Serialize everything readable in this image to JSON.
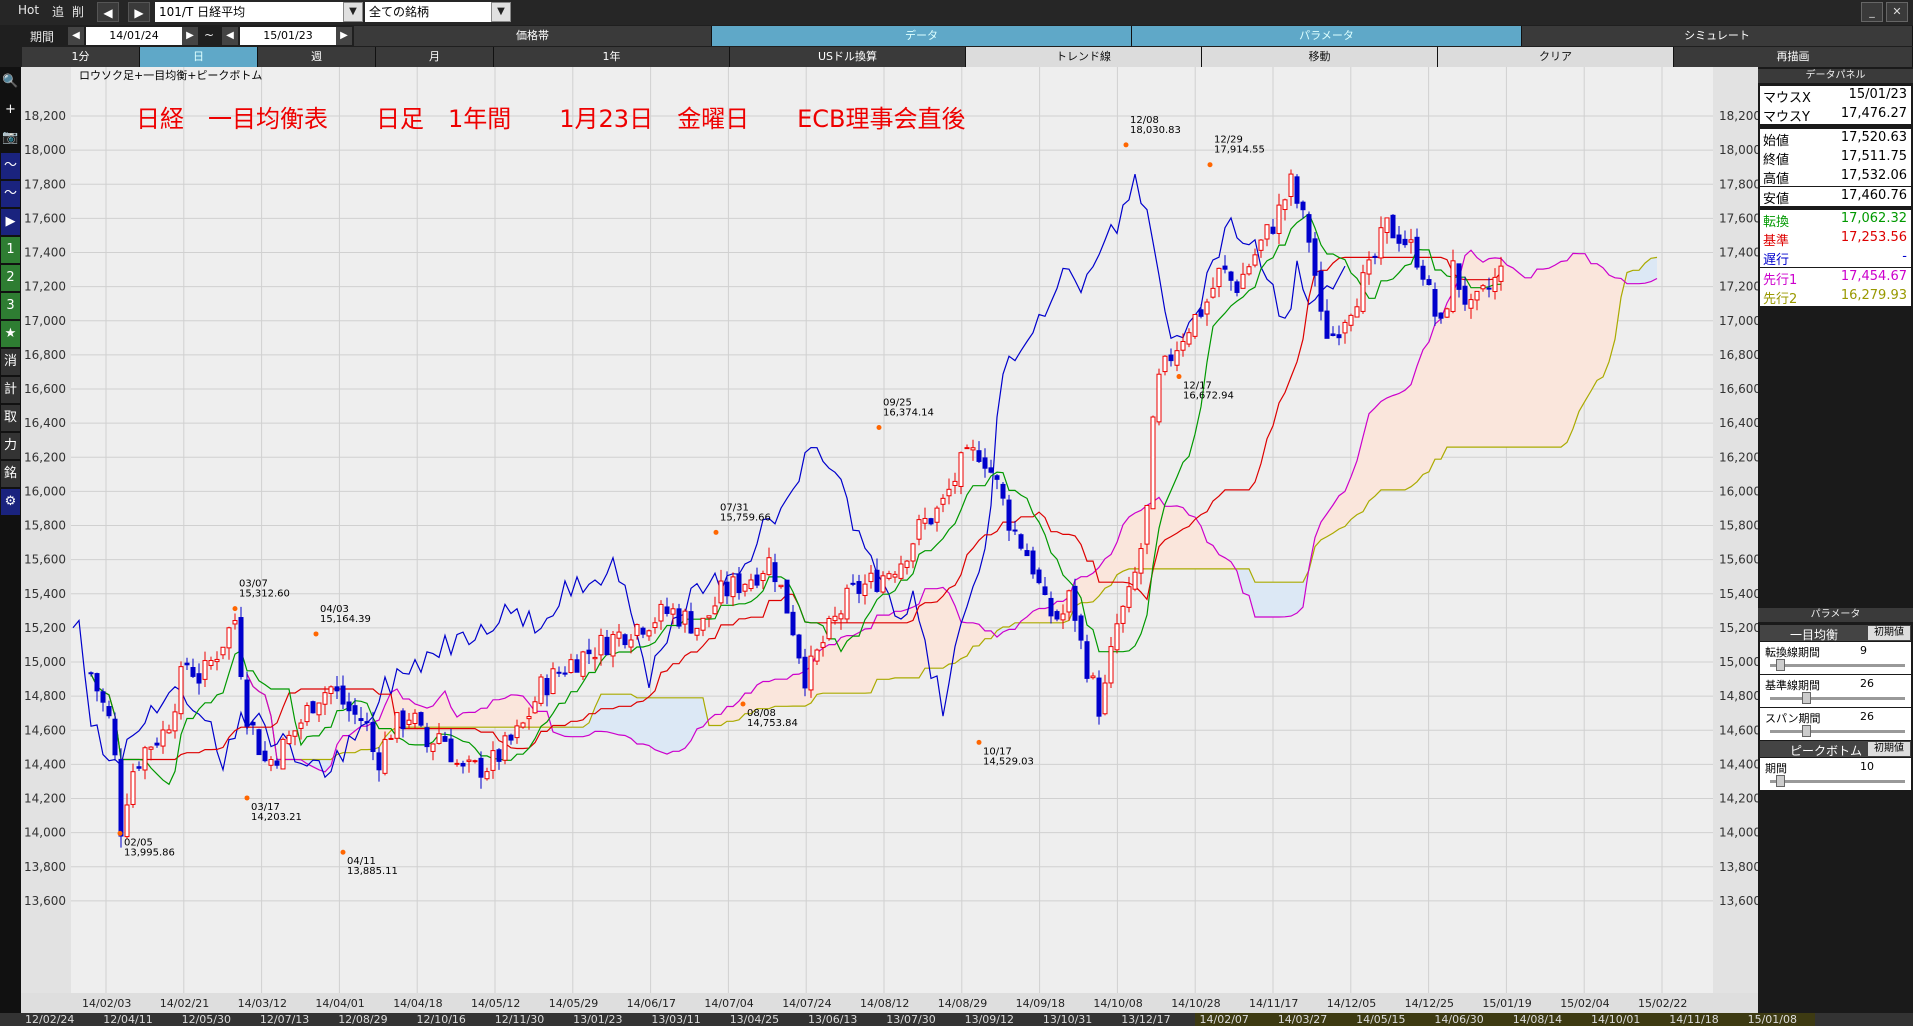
{
  "toolbar": {
    "hot": "Hot",
    "add": "追",
    "del": "削",
    "prev_symbol": "◀",
    "next_symbol": "▶",
    "symbol": "101/T 日経平均",
    "universe": "全ての銘柄",
    "dropdown": "▼"
  },
  "period": {
    "label": "期間",
    "from": "14/01/24",
    "to": "15/01/23",
    "tilde": "~"
  },
  "top_tabs": [
    "価格帯",
    "データ",
    "パラメータ",
    "シミュレート"
  ],
  "timeframes": [
    "1分",
    "日",
    "週",
    "月",
    "1年"
  ],
  "tools": [
    "USドル換算",
    "トレンド線",
    "移動",
    "クリア",
    "再描画"
  ],
  "sidebar_icons": [
    "🔍",
    "+",
    "📷",
    "〜",
    "〜",
    "▶",
    "1",
    "2",
    "3",
    "★",
    "消",
    "計",
    "取",
    "力",
    "銘",
    "⚙"
  ],
  "chart": {
    "indicator_label": "ロウソク足+一目均衡+ピークボトム",
    "headline": "日経　一目均衡表　　日足　1年間　　1月23日　金曜日　　ECB理事会直後",
    "y_ticks": [
      "18,200",
      "18,000",
      "17,800",
      "17,600",
      "17,400",
      "17,200",
      "17,000",
      "16,800",
      "16,600",
      "16,400",
      "16,200",
      "16,000",
      "15,800",
      "15,600",
      "15,400",
      "15,200",
      "15,000",
      "14,800",
      "14,600",
      "14,400",
      "14,200",
      "14,000",
      "13,800",
      "13,600"
    ],
    "x_ticks": [
      "14/02/03",
      "14/02/21",
      "14/03/12",
      "14/04/01",
      "14/04/18",
      "14/05/12",
      "14/05/29",
      "14/06/17",
      "14/07/04",
      "14/07/24",
      "14/08/12",
      "14/08/29",
      "14/09/18",
      "14/10/08",
      "14/10/28",
      "14/11/17",
      "14/12/05",
      "14/12/25",
      "15/01/19",
      "15/02/04",
      "15/02/22"
    ],
    "peaks": [
      {
        "date": "02/05",
        "value": "13,995.86"
      },
      {
        "date": "03/07",
        "value": "15,312.60"
      },
      {
        "date": "03/17",
        "value": "14,203.21"
      },
      {
        "date": "04/03",
        "value": "15,164.39"
      },
      {
        "date": "04/11",
        "value": "13,885.11"
      },
      {
        "date": "07/31",
        "value": "15,759.66"
      },
      {
        "date": "08/08",
        "value": "14,753.84"
      },
      {
        "date": "09/25",
        "value": "16,374.14"
      },
      {
        "date": "10/17",
        "value": "14,529.03"
      },
      {
        "date": "12/08",
        "value": "18,030.83"
      },
      {
        "date": "12/17",
        "value": "16,672.94"
      },
      {
        "date": "12/29",
        "value": "17,914.55"
      }
    ],
    "colors": {
      "tenkan": "#009900",
      "kijun": "#dd0000",
      "chikou": "#0000cc",
      "senkou1": "#cc00cc",
      "senkou2": "#aaaa00",
      "up_candle": "#ee0000",
      "down_candle": "#0000cc",
      "bull_cloud": "#fae6dc",
      "bear_cloud": "#dce8f5",
      "headline": "#ee0000"
    }
  },
  "bottom_strip": [
    "12/02/24",
    "12/04/11",
    "12/05/30",
    "12/07/13",
    "12/08/29",
    "12/10/16",
    "12/11/30",
    "13/01/23",
    "13/03/11",
    "13/04/25",
    "13/06/13",
    "13/07/30",
    "13/09/12",
    "13/10/31",
    "13/12/17",
    "14/02/07",
    "14/03/27",
    "14/05/15",
    "14/06/30",
    "14/08/14",
    "14/10/01",
    "14/11/18",
    "15/01/08"
  ],
  "data_panel": {
    "title": "データパネル",
    "rows": [
      {
        "label": "マウスX",
        "value": "15/01/23",
        "color": "#000000"
      },
      {
        "label": "マウスY",
        "value": "17,476.27",
        "color": "#000000"
      },
      {
        "label": "始値",
        "value": "17,520.63",
        "color": "#000000"
      },
      {
        "label": "終値",
        "value": "17,511.75",
        "color": "#000000"
      },
      {
        "label": "高値",
        "value": "17,532.06",
        "color": "#000000"
      },
      {
        "label": "安値",
        "value": "17,460.76",
        "color": "#000000"
      },
      {
        "label": "転換",
        "value": "17,062.32",
        "color": "#009900"
      },
      {
        "label": "基準",
        "value": "17,253.56",
        "color": "#dd0000"
      },
      {
        "label": "遅行",
        "value": "-",
        "color": "#0000cc"
      },
      {
        "label": "先行1",
        "value": "17,454.67",
        "color": "#cc00cc"
      },
      {
        "label": "先行2",
        "value": "16,279.93",
        "color": "#999900"
      }
    ]
  },
  "param_panel": {
    "title": "パラメータ",
    "reset": "初期値",
    "ichimoku": {
      "title": "一目均衡",
      "params": [
        {
          "label": "転換線期間",
          "value": "9",
          "level": 0.05
        },
        {
          "label": "基準線期間",
          "value": "26",
          "level": 0.25
        },
        {
          "label": "スパン期間",
          "value": "26",
          "level": 0.25
        }
      ]
    },
    "peakbottom": {
      "title": "ピークボトム",
      "params": [
        {
          "label": "期間",
          "value": "10",
          "level": 0.05
        }
      ]
    }
  },
  "chart_data": {
    "type": "candlestick",
    "x_range": [
      "14/01/24",
      "15/02/22"
    ],
    "ylim": [
      13600,
      18200
    ],
    "reference_points": [
      {
        "x": "14/02/05",
        "y": 13995.86
      },
      {
        "x": "14/03/07",
        "y": 15312.6
      },
      {
        "x": "14/03/17",
        "y": 14203.21
      },
      {
        "x": "14/04/03",
        "y": 15164.39
      },
      {
        "x": "14/04/11",
        "y": 13885.11
      },
      {
        "x": "14/07/31",
        "y": 15759.66
      },
      {
        "x": "14/08/08",
        "y": 14753.84
      },
      {
        "x": "14/09/25",
        "y": 16374.14
      },
      {
        "x": "14/10/17",
        "y": 14529.03
      },
      {
        "x": "14/12/08",
        "y": 18030.83
      },
      {
        "x": "14/12/17",
        "y": 16672.94
      },
      {
        "x": "14/12/29",
        "y": 17914.55
      },
      {
        "x": "15/01/23",
        "y": 17511.75
      }
    ]
  }
}
